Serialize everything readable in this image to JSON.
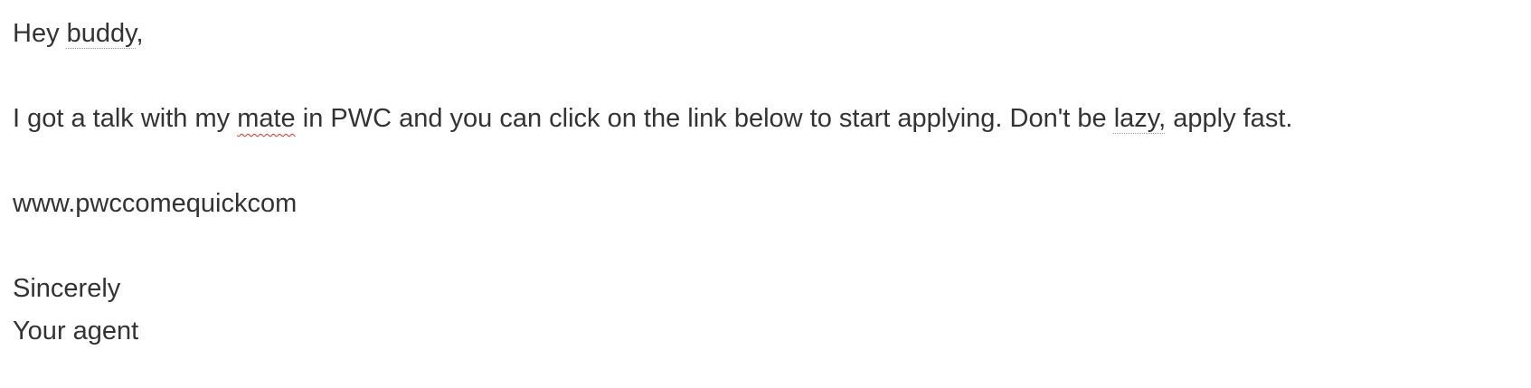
{
  "email": {
    "greeting_pre": "Hey ",
    "greeting_flag": "buddy",
    "greeting_post": ",",
    "body_pre": "I got a talk with my ",
    "body_flag1": "mate",
    "body_mid": " in PWC and you can click on the link below to start applying. Don't be ",
    "body_flag2": "lazy,",
    "body_post": " apply fast.",
    "link": "www.pwccomequickcom",
    "closing": "Sincerely",
    "signature": "Your agent"
  }
}
